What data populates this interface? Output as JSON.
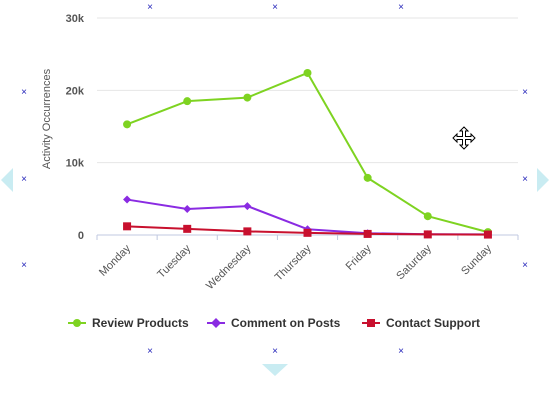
{
  "chart_data": {
    "type": "line",
    "categories": [
      "Monday",
      "Tuesday",
      "Wednesday",
      "Thursday",
      "Friday",
      "Saturday",
      "Sunday"
    ],
    "ylabel": "Activity Occurrences",
    "ylim": [
      0,
      30000
    ],
    "yticks": [
      {
        "value": 0,
        "label": "0"
      },
      {
        "value": 10000,
        "label": "10k"
      },
      {
        "value": 20000,
        "label": "20k"
      },
      {
        "value": 30000,
        "label": "30k"
      }
    ],
    "grid": true,
    "legend_position": "bottom",
    "series": [
      {
        "name": "Review Products",
        "color": "#7ed321",
        "marker": "circle",
        "values": [
          15300,
          18500,
          19000,
          22400,
          7900,
          2600,
          400
        ]
      },
      {
        "name": "Comment on Posts",
        "color": "#8a2be2",
        "marker": "diamond",
        "values": [
          4900,
          3600,
          4000,
          800,
          250,
          100,
          80
        ]
      },
      {
        "name": "Contact Support",
        "color": "#c8102e",
        "marker": "square",
        "values": [
          1200,
          850,
          500,
          300,
          150,
          80,
          60
        ]
      }
    ]
  },
  "ui": {
    "handle_glyph": "×",
    "handle_color": "#1f1fb8",
    "arrow_color": "#c9ecf2",
    "icons": {
      "resize_handle": "close-icon",
      "left_arrow": "chevron-left-icon",
      "right_arrow": "chevron-right-icon",
      "bottom_arrow": "chevron-down-icon",
      "cursor": "move-cursor-icon"
    }
  }
}
